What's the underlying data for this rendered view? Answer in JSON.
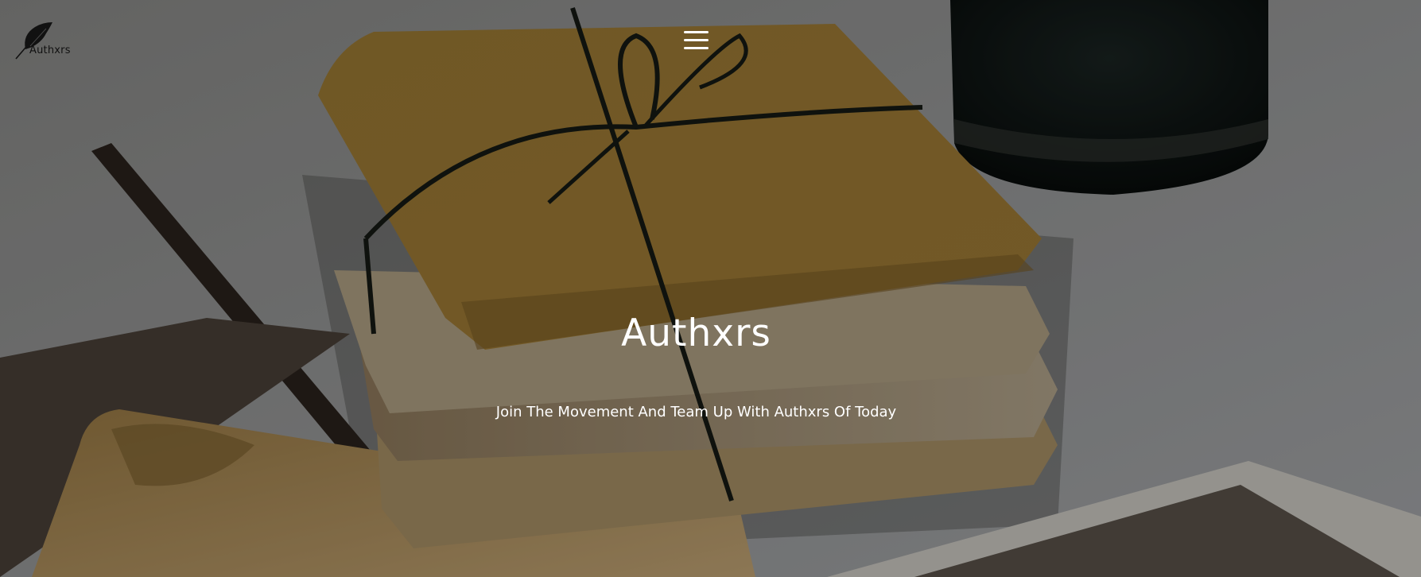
{
  "brand": {
    "logo_text": "Authxrs",
    "logo_icon": "quill-feather-icon"
  },
  "nav": {
    "menu_icon": "hamburger-menu-icon"
  },
  "hero": {
    "title": "Authxrs",
    "subtitle": "Join The Movement And Team Up With Authxrs Of Today",
    "background": "photo-stack-of-old-papers-tied-with-string"
  }
}
